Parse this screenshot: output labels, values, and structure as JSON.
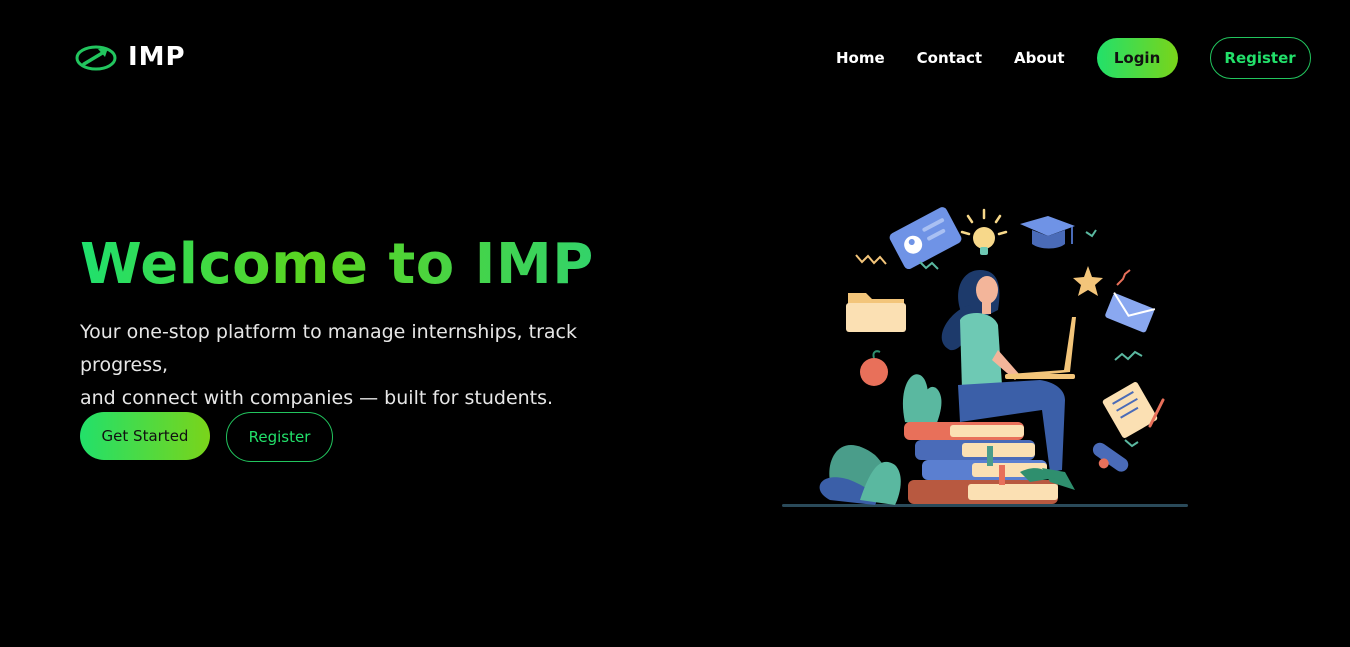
{
  "brand": {
    "name": "IMP",
    "logo_icon": "arrow-circle-icon",
    "accent_start": "#22e06a",
    "accent_end": "#7ad41a"
  },
  "nav": {
    "links": [
      {
        "label": "Home"
      },
      {
        "label": "Contact"
      },
      {
        "label": "About"
      }
    ],
    "login_label": "Login",
    "register_label": "Register"
  },
  "hero": {
    "title": "Welcome to IMP",
    "subtitle_line1": "Your one-stop platform to manage internships, track progress,",
    "subtitle_line2": "and connect with companies — built for students.",
    "primary_cta": "Get Started",
    "secondary_cta": "Register",
    "illustration": "student-studying-on-books-illustration"
  }
}
